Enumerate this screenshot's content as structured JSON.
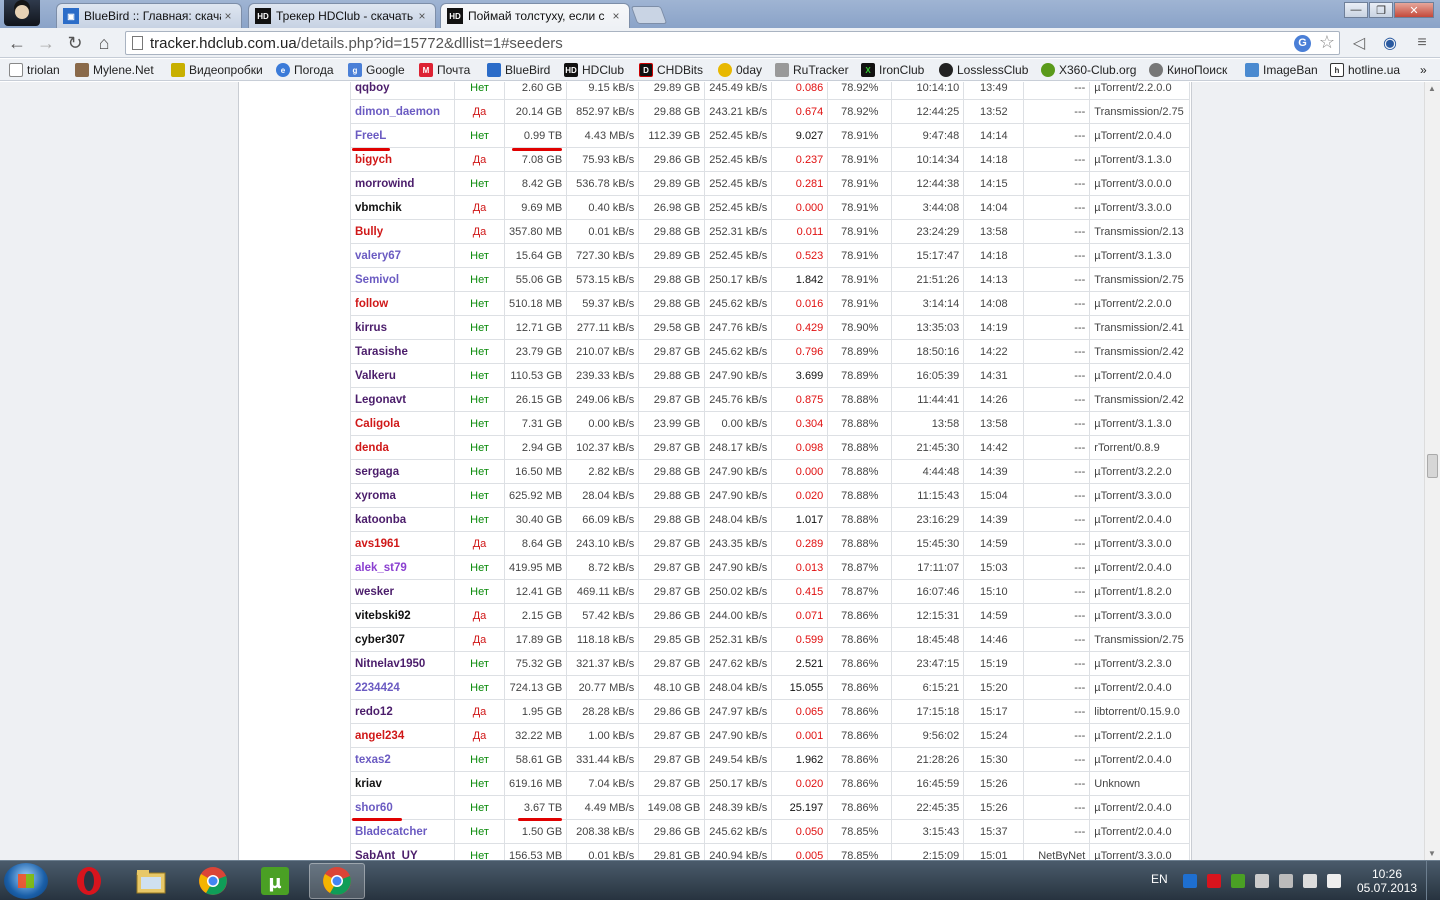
{
  "browser": {
    "tabs": [
      {
        "title": "BlueBird :: Главная: скача",
        "favicon": "bluebird-icon",
        "active": false
      },
      {
        "title": "Трекер HDClub - скачать",
        "favicon": "hdclub-icon",
        "active": false
      },
      {
        "title": "Поймай толстуху, если с",
        "favicon": "hdclub-icon",
        "active": true
      }
    ],
    "window_controls": {
      "minimize": "—",
      "maximize": "❐",
      "close": "✕"
    },
    "url": {
      "domain": "tracker.hdclub.com.ua",
      "path": "/details.php?id=15772&dllist=1#seeders"
    },
    "bookmarks": [
      {
        "label": "triolan",
        "icon": "page-icon"
      },
      {
        "label": "Mylene.Net",
        "icon": "photo-icon"
      },
      {
        "label": "Видеопробки",
        "icon": "traffic-icon"
      },
      {
        "label": "Погода",
        "icon": "weather-icon"
      },
      {
        "label": "Google",
        "icon": "google-icon"
      },
      {
        "label": "Почта",
        "icon": "mail-icon"
      },
      {
        "label": "BlueBird",
        "icon": "bluebird-icon"
      },
      {
        "label": "HDClub",
        "icon": "hdclub-icon"
      },
      {
        "label": "CHDBits",
        "icon": "chdbits-icon"
      },
      {
        "label": "0day",
        "icon": "0day-icon"
      },
      {
        "label": "RuTracker",
        "icon": "rutracker-icon"
      },
      {
        "label": "IronClub",
        "icon": "ironclub-icon"
      },
      {
        "label": "LosslessClub",
        "icon": "losslessclub-icon"
      },
      {
        "label": "X360-Club.org",
        "icon": "x360-icon"
      },
      {
        "label": "КиноПоиск",
        "icon": "kinopoisk-icon"
      },
      {
        "label": "ImageBan",
        "icon": "imageban-icon"
      },
      {
        "label": "hotline.ua",
        "icon": "hotline-icon"
      }
    ],
    "bookmarks_overflow": "»"
  },
  "colors": {
    "seed_no": "#0a8a0a",
    "seed_yes": "#d01818",
    "ratio_low": "#e01010",
    "ratio_high": "#111111",
    "annotation": "#e00000"
  },
  "peers": [
    {
      "name": "qqboy",
      "color": "#4b1d6b",
      "seed": "Нет",
      "uploaded": "2.60 GB",
      "up_rate": "9.15 kB/s",
      "downloaded": "29.89 GB",
      "down_rate": "245.49 kB/s",
      "ratio": "0.086",
      "ratio_low": true,
      "complete": "78.92%",
      "connected": "10:14:10",
      "idle": "13:49",
      "ip": "---",
      "client": "µTorrent/2.2.0.0"
    },
    {
      "name": "dimon_daemon",
      "color": "#6b5bc2",
      "seed": "Да",
      "uploaded": "20.14 GB",
      "up_rate": "852.97 kB/s",
      "downloaded": "29.88 GB",
      "down_rate": "243.21 kB/s",
      "ratio": "0.674",
      "ratio_low": true,
      "complete": "78.92%",
      "connected": "12:44:25",
      "idle": "13:52",
      "ip": "---",
      "client": "Transmission/2.75"
    },
    {
      "name": "FreeL",
      "color": "#6b5bc2",
      "seed": "Нет",
      "uploaded": "0.99 TB",
      "up_rate": "4.43 MB/s",
      "downloaded": "112.39 GB",
      "down_rate": "252.45 kB/s",
      "ratio": "9.027",
      "ratio_low": false,
      "complete": "78.91%",
      "connected": "9:47:48",
      "idle": "14:14",
      "ip": "---",
      "client": "µTorrent/2.0.4.0"
    },
    {
      "name": "bigych",
      "color": "#d01818",
      "seed": "Да",
      "uploaded": "7.08 GB",
      "up_rate": "75.93 kB/s",
      "downloaded": "29.86 GB",
      "down_rate": "252.45 kB/s",
      "ratio": "0.237",
      "ratio_low": true,
      "complete": "78.91%",
      "connected": "10:14:34",
      "idle": "14:18",
      "ip": "---",
      "client": "µTorrent/3.1.3.0"
    },
    {
      "name": "morrowind",
      "color": "#4b1d6b",
      "seed": "Нет",
      "uploaded": "8.42 GB",
      "up_rate": "536.78 kB/s",
      "downloaded": "29.89 GB",
      "down_rate": "252.45 kB/s",
      "ratio": "0.281",
      "ratio_low": true,
      "complete": "78.91%",
      "connected": "12:44:38",
      "idle": "14:15",
      "ip": "---",
      "client": "µTorrent/3.0.0.0"
    },
    {
      "name": "vbmchik",
      "color": "#111111",
      "seed": "Да",
      "uploaded": "9.69 MB",
      "up_rate": "0.40 kB/s",
      "downloaded": "26.98 GB",
      "down_rate": "252.45 kB/s",
      "ratio": "0.000",
      "ratio_low": true,
      "complete": "78.91%",
      "connected": "3:44:08",
      "idle": "14:04",
      "ip": "---",
      "client": "µTorrent/3.3.0.0"
    },
    {
      "name": "Bully",
      "color": "#d01818",
      "seed": "Да",
      "uploaded": "357.80 MB",
      "up_rate": "0.01 kB/s",
      "downloaded": "29.88 GB",
      "down_rate": "252.31 kB/s",
      "ratio": "0.011",
      "ratio_low": true,
      "complete": "78.91%",
      "connected": "23:24:29",
      "idle": "13:58",
      "ip": "---",
      "client": "Transmission/2.13"
    },
    {
      "name": "valery67",
      "color": "#6b5bc2",
      "seed": "Нет",
      "uploaded": "15.64 GB",
      "up_rate": "727.30 kB/s",
      "downloaded": "29.89 GB",
      "down_rate": "252.45 kB/s",
      "ratio": "0.523",
      "ratio_low": true,
      "complete": "78.91%",
      "connected": "15:17:47",
      "idle": "14:18",
      "ip": "---",
      "client": "µTorrent/3.1.3.0"
    },
    {
      "name": "Semivol",
      "color": "#6b5bc2",
      "seed": "Нет",
      "uploaded": "55.06 GB",
      "up_rate": "573.15 kB/s",
      "downloaded": "29.88 GB",
      "down_rate": "250.17 kB/s",
      "ratio": "1.842",
      "ratio_low": false,
      "complete": "78.91%",
      "connected": "21:51:26",
      "idle": "14:13",
      "ip": "---",
      "client": "Transmission/2.75"
    },
    {
      "name": "follow",
      "color": "#d01818",
      "seed": "Нет",
      "uploaded": "510.18 MB",
      "up_rate": "59.37 kB/s",
      "downloaded": "29.88 GB",
      "down_rate": "245.62 kB/s",
      "ratio": "0.016",
      "ratio_low": true,
      "complete": "78.91%",
      "connected": "3:14:14",
      "idle": "14:08",
      "ip": "---",
      "client": "µTorrent/2.2.0.0"
    },
    {
      "name": "kirrus",
      "color": "#4b1d6b",
      "seed": "Нет",
      "uploaded": "12.71 GB",
      "up_rate": "277.11 kB/s",
      "downloaded": "29.58 GB",
      "down_rate": "247.76 kB/s",
      "ratio": "0.429",
      "ratio_low": true,
      "complete": "78.90%",
      "connected": "13:35:03",
      "idle": "14:19",
      "ip": "---",
      "client": "Transmission/2.41"
    },
    {
      "name": "Tarasishe",
      "color": "#4b1d6b",
      "seed": "Нет",
      "uploaded": "23.79 GB",
      "up_rate": "210.07 kB/s",
      "downloaded": "29.87 GB",
      "down_rate": "245.62 kB/s",
      "ratio": "0.796",
      "ratio_low": true,
      "complete": "78.89%",
      "connected": "18:50:16",
      "idle": "14:22",
      "ip": "---",
      "client": "Transmission/2.42"
    },
    {
      "name": "Valkeru",
      "color": "#4b1d6b",
      "seed": "Нет",
      "uploaded": "110.53 GB",
      "up_rate": "239.33 kB/s",
      "downloaded": "29.88 GB",
      "down_rate": "247.90 kB/s",
      "ratio": "3.699",
      "ratio_low": false,
      "complete": "78.89%",
      "connected": "16:05:39",
      "idle": "14:31",
      "ip": "---",
      "client": "µTorrent/2.0.4.0"
    },
    {
      "name": "Legonavt",
      "color": "#4b1d6b",
      "seed": "Нет",
      "uploaded": "26.15 GB",
      "up_rate": "249.06 kB/s",
      "downloaded": "29.87 GB",
      "down_rate": "245.76 kB/s",
      "ratio": "0.875",
      "ratio_low": true,
      "complete": "78.88%",
      "connected": "11:44:41",
      "idle": "14:26",
      "ip": "---",
      "client": "Transmission/2.42"
    },
    {
      "name": "Caligola",
      "color": "#d01818",
      "seed": "Нет",
      "uploaded": "7.31 GB",
      "up_rate": "0.00 kB/s",
      "downloaded": "23.99 GB",
      "down_rate": "0.00 kB/s",
      "ratio": "0.304",
      "ratio_low": true,
      "complete": "78.88%",
      "connected": "13:58",
      "idle": "13:58",
      "ip": "---",
      "client": "µTorrent/3.1.3.0"
    },
    {
      "name": "denda",
      "color": "#d01818",
      "seed": "Нет",
      "uploaded": "2.94 GB",
      "up_rate": "102.37 kB/s",
      "downloaded": "29.87 GB",
      "down_rate": "248.17 kB/s",
      "ratio": "0.098",
      "ratio_low": true,
      "complete": "78.88%",
      "connected": "21:45:30",
      "idle": "14:42",
      "ip": "---",
      "client": "rTorrent/0.8.9"
    },
    {
      "name": "sergaga",
      "color": "#4b1d6b",
      "seed": "Нет",
      "uploaded": "16.50 MB",
      "up_rate": "2.82 kB/s",
      "downloaded": "29.88 GB",
      "down_rate": "247.90 kB/s",
      "ratio": "0.000",
      "ratio_low": true,
      "complete": "78.88%",
      "connected": "4:44:48",
      "idle": "14:39",
      "ip": "---",
      "client": "µTorrent/3.2.2.0"
    },
    {
      "name": "xyroma",
      "color": "#4b1d6b",
      "seed": "Нет",
      "uploaded": "625.92 MB",
      "up_rate": "28.04 kB/s",
      "downloaded": "29.88 GB",
      "down_rate": "247.90 kB/s",
      "ratio": "0.020",
      "ratio_low": true,
      "complete": "78.88%",
      "connected": "11:15:43",
      "idle": "15:04",
      "ip": "---",
      "client": "µTorrent/3.3.0.0"
    },
    {
      "name": "katoonba",
      "color": "#4b1d6b",
      "seed": "Нет",
      "uploaded": "30.40 GB",
      "up_rate": "66.09 kB/s",
      "downloaded": "29.88 GB",
      "down_rate": "248.04 kB/s",
      "ratio": "1.017",
      "ratio_low": false,
      "complete": "78.88%",
      "connected": "23:16:29",
      "idle": "14:39",
      "ip": "---",
      "client": "µTorrent/2.0.4.0"
    },
    {
      "name": "avs1961",
      "color": "#d01818",
      "seed": "Да",
      "uploaded": "8.64 GB",
      "up_rate": "243.10 kB/s",
      "downloaded": "29.87 GB",
      "down_rate": "243.35 kB/s",
      "ratio": "0.289",
      "ratio_low": true,
      "complete": "78.88%",
      "connected": "15:45:30",
      "idle": "14:59",
      "ip": "---",
      "client": "µTorrent/3.3.0.0"
    },
    {
      "name": "alek_st79",
      "color": "#8a3fd0",
      "seed": "Нет",
      "uploaded": "419.95 MB",
      "up_rate": "8.72 kB/s",
      "downloaded": "29.87 GB",
      "down_rate": "247.90 kB/s",
      "ratio": "0.013",
      "ratio_low": true,
      "complete": "78.87%",
      "connected": "17:11:07",
      "idle": "15:03",
      "ip": "---",
      "client": "µTorrent/2.0.4.0"
    },
    {
      "name": "wesker",
      "color": "#4b1d6b",
      "seed": "Нет",
      "uploaded": "12.41 GB",
      "up_rate": "469.11 kB/s",
      "downloaded": "29.87 GB",
      "down_rate": "250.02 kB/s",
      "ratio": "0.415",
      "ratio_low": true,
      "complete": "78.87%",
      "connected": "16:07:46",
      "idle": "15:10",
      "ip": "---",
      "client": "µTorrent/1.8.2.0"
    },
    {
      "name": "vitebski92",
      "color": "#111111",
      "seed": "Да",
      "uploaded": "2.15 GB",
      "up_rate": "57.42 kB/s",
      "downloaded": "29.86 GB",
      "down_rate": "244.00 kB/s",
      "ratio": "0.071",
      "ratio_low": true,
      "complete": "78.86%",
      "connected": "12:15:31",
      "idle": "14:59",
      "ip": "---",
      "client": "µTorrent/3.3.0.0"
    },
    {
      "name": "cyber307",
      "color": "#111111",
      "seed": "Да",
      "uploaded": "17.89 GB",
      "up_rate": "118.18 kB/s",
      "downloaded": "29.85 GB",
      "down_rate": "252.31 kB/s",
      "ratio": "0.599",
      "ratio_low": true,
      "complete": "78.86%",
      "connected": "18:45:48",
      "idle": "14:46",
      "ip": "---",
      "client": "Transmission/2.75"
    },
    {
      "name": "Nitnelav1950",
      "color": "#4b1d6b",
      "seed": "Нет",
      "uploaded": "75.32 GB",
      "up_rate": "321.37 kB/s",
      "downloaded": "29.87 GB",
      "down_rate": "247.62 kB/s",
      "ratio": "2.521",
      "ratio_low": false,
      "complete": "78.86%",
      "connected": "23:47:15",
      "idle": "15:19",
      "ip": "---",
      "client": "µTorrent/3.2.3.0"
    },
    {
      "name": "2234424",
      "color": "#6b5bc2",
      "seed": "Нет",
      "uploaded": "724.13 GB",
      "up_rate": "20.77 MB/s",
      "downloaded": "48.10 GB",
      "down_rate": "248.04 kB/s",
      "ratio": "15.055",
      "ratio_low": false,
      "complete": "78.86%",
      "connected": "6:15:21",
      "idle": "15:20",
      "ip": "---",
      "client": "µTorrent/2.0.4.0"
    },
    {
      "name": "redo12",
      "color": "#4b1d6b",
      "seed": "Да",
      "uploaded": "1.95 GB",
      "up_rate": "28.28 kB/s",
      "downloaded": "29.86 GB",
      "down_rate": "247.97 kB/s",
      "ratio": "0.065",
      "ratio_low": true,
      "complete": "78.86%",
      "connected": "17:15:18",
      "idle": "15:17",
      "ip": "---",
      "client": "libtorrent/0.15.9.0"
    },
    {
      "name": "angel234",
      "color": "#d01818",
      "seed": "Да",
      "uploaded": "32.22 MB",
      "up_rate": "1.00 kB/s",
      "downloaded": "29.87 GB",
      "down_rate": "247.90 kB/s",
      "ratio": "0.001",
      "ratio_low": true,
      "complete": "78.86%",
      "connected": "9:56:02",
      "idle": "15:24",
      "ip": "---",
      "client": "µTorrent/2.2.1.0"
    },
    {
      "name": "texas2",
      "color": "#6b5bc2",
      "seed": "Нет",
      "uploaded": "58.61 GB",
      "up_rate": "331.44 kB/s",
      "downloaded": "29.87 GB",
      "down_rate": "249.54 kB/s",
      "ratio": "1.962",
      "ratio_low": false,
      "complete": "78.86%",
      "connected": "21:28:26",
      "idle": "15:30",
      "ip": "---",
      "client": "µTorrent/2.0.4.0"
    },
    {
      "name": "kriav",
      "color": "#111111",
      "seed": "Нет",
      "uploaded": "619.16 MB",
      "up_rate": "7.04 kB/s",
      "downloaded": "29.87 GB",
      "down_rate": "250.17 kB/s",
      "ratio": "0.020",
      "ratio_low": true,
      "complete": "78.86%",
      "connected": "16:45:59",
      "idle": "15:26",
      "ip": "---",
      "client": "Unknown"
    },
    {
      "name": "shor60",
      "color": "#6b5bc2",
      "seed": "Нет",
      "uploaded": "3.67 TB",
      "up_rate": "4.49 MB/s",
      "downloaded": "149.08 GB",
      "down_rate": "248.39 kB/s",
      "ratio": "25.197",
      "ratio_low": false,
      "complete": "78.86%",
      "connected": "22:45:35",
      "idle": "15:26",
      "ip": "---",
      "client": "µTorrent/2.0.4.0"
    },
    {
      "name": "Bladecatcher",
      "color": "#6b5bc2",
      "seed": "Нет",
      "uploaded": "1.50 GB",
      "up_rate": "208.38 kB/s",
      "downloaded": "29.86 GB",
      "down_rate": "245.62 kB/s",
      "ratio": "0.050",
      "ratio_low": true,
      "complete": "78.85%",
      "connected": "3:15:43",
      "idle": "15:37",
      "ip": "---",
      "client": "µTorrent/2.0.4.0"
    },
    {
      "name": "SabAnt_UY",
      "color": "#4b1d6b",
      "seed": "Нет",
      "uploaded": "156.53 MB",
      "up_rate": "0.01 kB/s",
      "downloaded": "29.81 GB",
      "down_rate": "240.94 kB/s",
      "ratio": "0.005",
      "ratio_low": true,
      "complete": "78.85%",
      "connected": "2:15:09",
      "idle": "15:01",
      "ip": "NetByNet",
      "client": "µTorrent/3.3.0.0"
    }
  ],
  "taskbar": {
    "apps": [
      "opera-icon",
      "file-explorer-icon",
      "chrome-icon",
      "utorrent-icon",
      "chrome-icon"
    ],
    "language": "EN",
    "time": "10:26",
    "date": "05.07.2013"
  }
}
